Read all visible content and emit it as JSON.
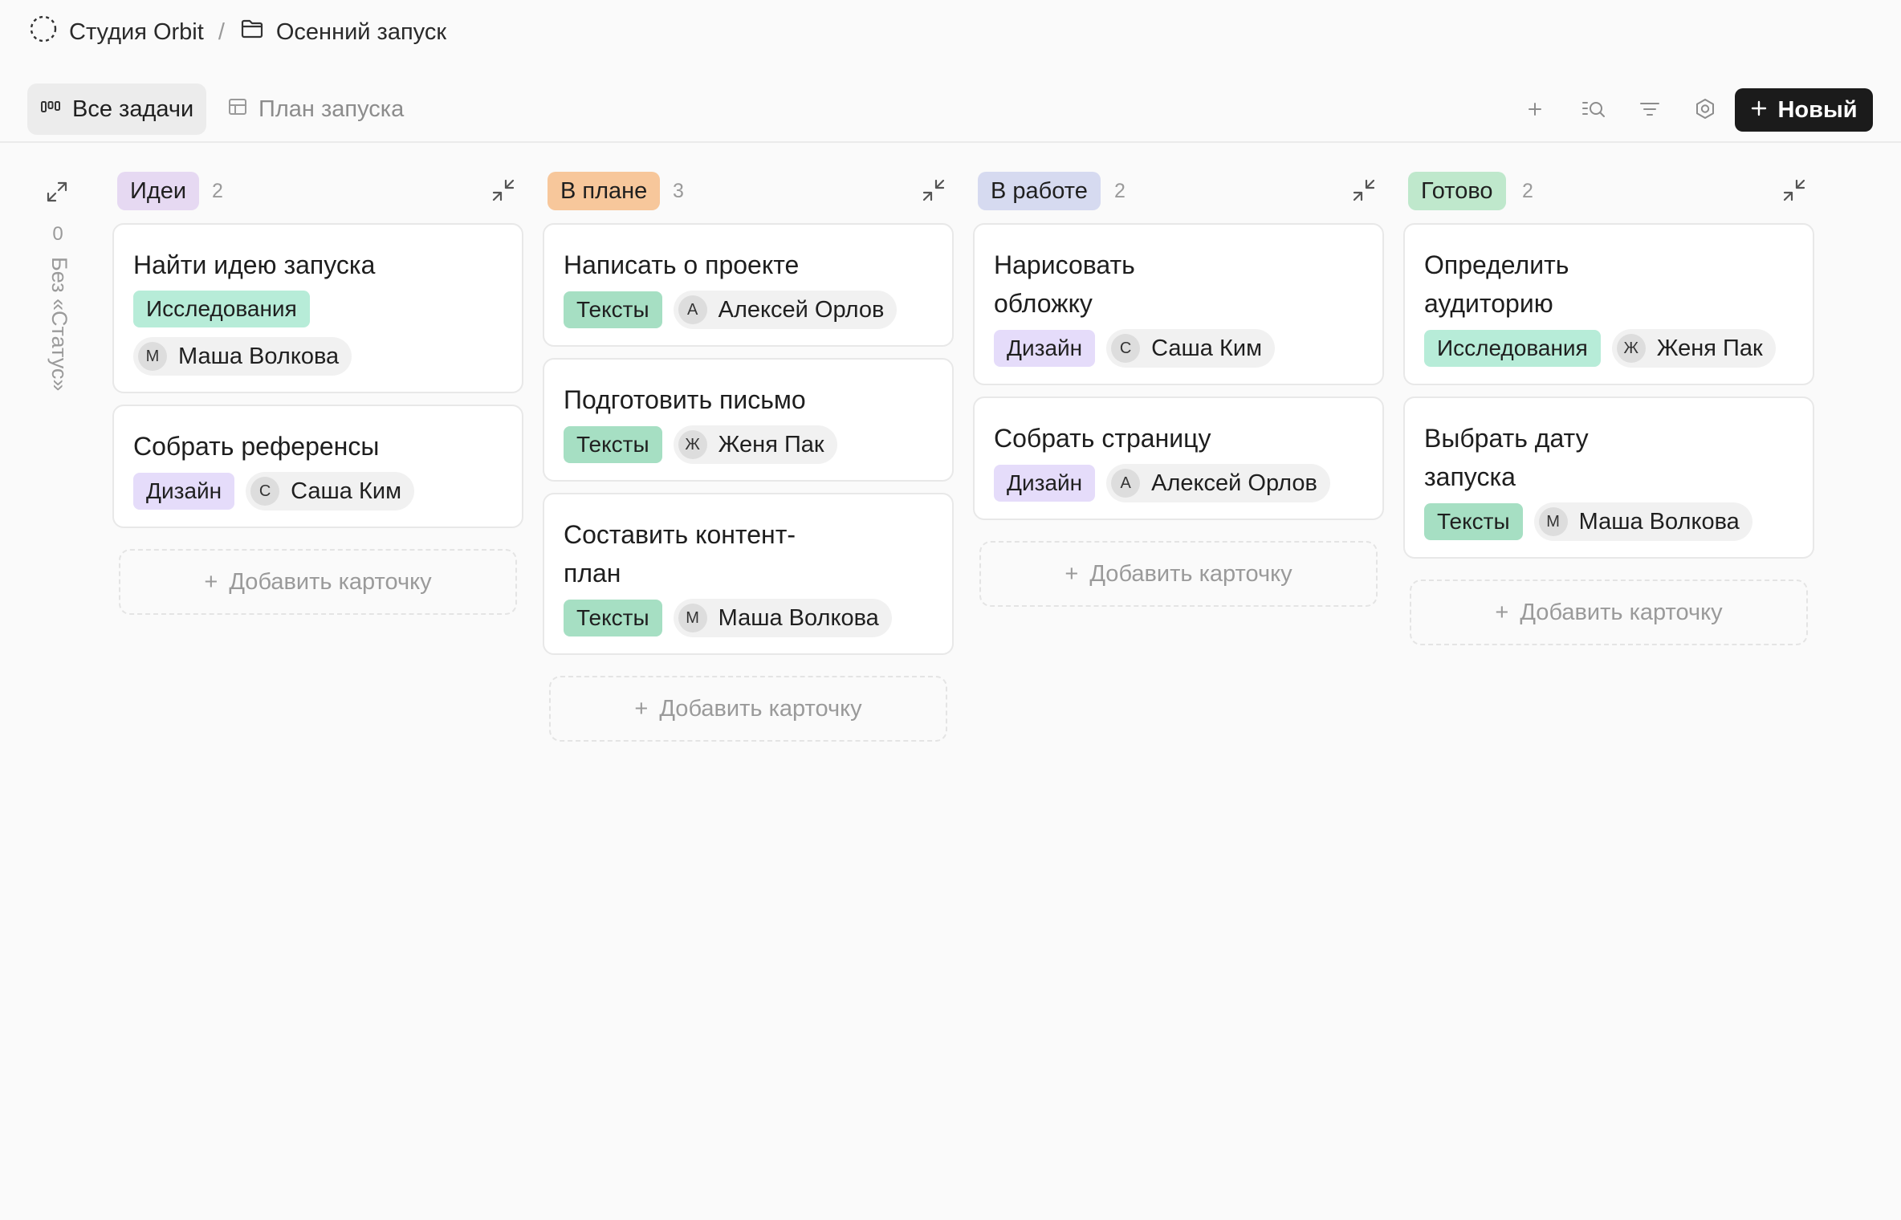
{
  "breadcrumb": {
    "workspace": "Студия Orbit",
    "separator": "/",
    "project": "Осенний запуск"
  },
  "views": {
    "active": "Все задачи",
    "inactive": "План запуска"
  },
  "toolbar": {
    "new_label": "Новый"
  },
  "no_status": {
    "count": "0",
    "label": "Без «Статус»"
  },
  "add_card_label": "Добавить карточку",
  "columns": [
    {
      "name": "Идеи",
      "count": "2",
      "color": "#e6d9f2",
      "cards": [
        {
          "title": "Найти идею запуска",
          "tag": "Исследования",
          "tag_color": "#b7ecd8",
          "initial": "М",
          "person": "Маша Волкова"
        },
        {
          "title": "Собрать референсы",
          "tag": "Дизайн",
          "tag_color": "#e5dcfa",
          "initial": "С",
          "person": "Саша Ким"
        }
      ]
    },
    {
      "name": "В плане",
      "count": "3",
      "color": "#f7c79b",
      "cards": [
        {
          "title": "Написать о проекте",
          "tag": "Тексты",
          "tag_color": "#a6dfc3",
          "initial": "А",
          "person": "Алексей Орлов"
        },
        {
          "title": "Подготовить письмо",
          "tag": "Тексты",
          "tag_color": "#a6dfc3",
          "initial": "Ж",
          "person": "Женя Пак"
        },
        {
          "title": "Составить контент-план",
          "tag": "Тексты",
          "tag_color": "#a6dfc3",
          "initial": "М",
          "person": "Маша Волкова"
        }
      ]
    },
    {
      "name": "В работе",
      "count": "2",
      "color": "#d6daf0",
      "cards": [
        {
          "title": "Нарисовать обложку",
          "tag": "Дизайн",
          "tag_color": "#e5dcfa",
          "initial": "С",
          "person": "Саша Ким"
        },
        {
          "title": "Собрать страницу",
          "tag": "Дизайн",
          "tag_color": "#e5dcfa",
          "initial": "А",
          "person": "Алексей Орлов"
        }
      ]
    },
    {
      "name": "Готово",
      "count": "2",
      "color": "#bfe8cc",
      "cards": [
        {
          "title": "Определить аудиторию",
          "tag": "Исследования",
          "tag_color": "#b7ecd8",
          "initial": "Ж",
          "person": "Женя Пак"
        },
        {
          "title": "Выбрать дату запуска",
          "tag": "Тексты",
          "tag_color": "#a6dfc3",
          "initial": "М",
          "person": "Маша Волкова"
        }
      ]
    }
  ]
}
